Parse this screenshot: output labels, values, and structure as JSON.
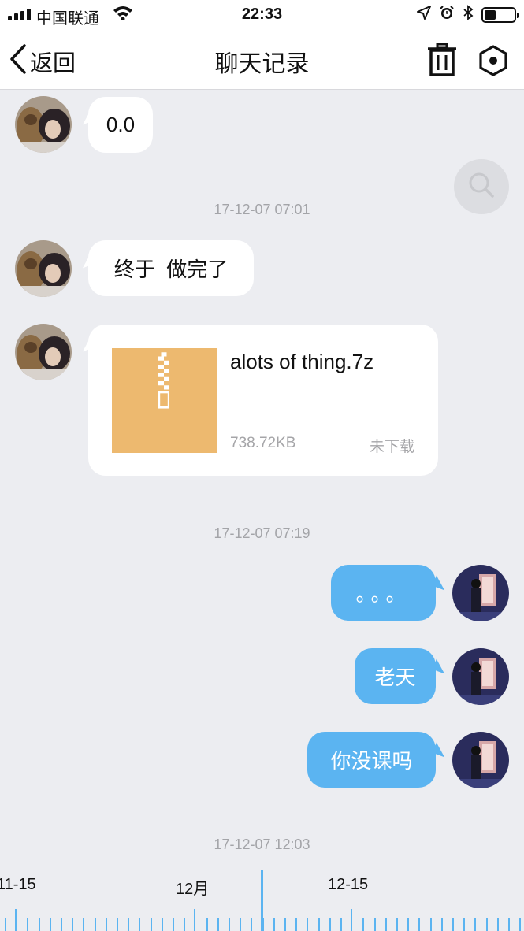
{
  "status_bar": {
    "carrier": "中国联通",
    "time": "22:33",
    "battery_level": 0.4,
    "icons": [
      "signal-icon",
      "wifi-icon",
      "location-icon",
      "alarm-icon",
      "bluetooth-icon",
      "battery-icon"
    ]
  },
  "nav": {
    "back_label": "返回",
    "title": "聊天记录",
    "icons": [
      "chevron-left-icon",
      "trash-icon",
      "settings-icon"
    ]
  },
  "messages": [
    {
      "side": "in",
      "type": "text",
      "text": "0.0"
    },
    {
      "side": "time",
      "text": "17-12-07 07:01"
    },
    {
      "side": "in",
      "type": "text",
      "text": "终于  做完了"
    },
    {
      "side": "in",
      "type": "file",
      "file_name": "alots of thing.7z",
      "file_size": "738.72KB",
      "file_status": "未下载"
    },
    {
      "side": "time",
      "text": "17-12-07 07:19"
    },
    {
      "side": "out",
      "type": "text",
      "text": "。。。"
    },
    {
      "side": "out",
      "type": "text",
      "text": "老天"
    },
    {
      "side": "out",
      "type": "text",
      "text": "你没课吗"
    },
    {
      "side": "time",
      "text": "17-12-07 12:03"
    }
  ],
  "timeline": {
    "labels": [
      "11-15",
      "12月",
      "12-15"
    ]
  },
  "colors": {
    "accent": "#5bb4f1",
    "background": "#ecedf1",
    "file_icon": "#edb96f"
  }
}
